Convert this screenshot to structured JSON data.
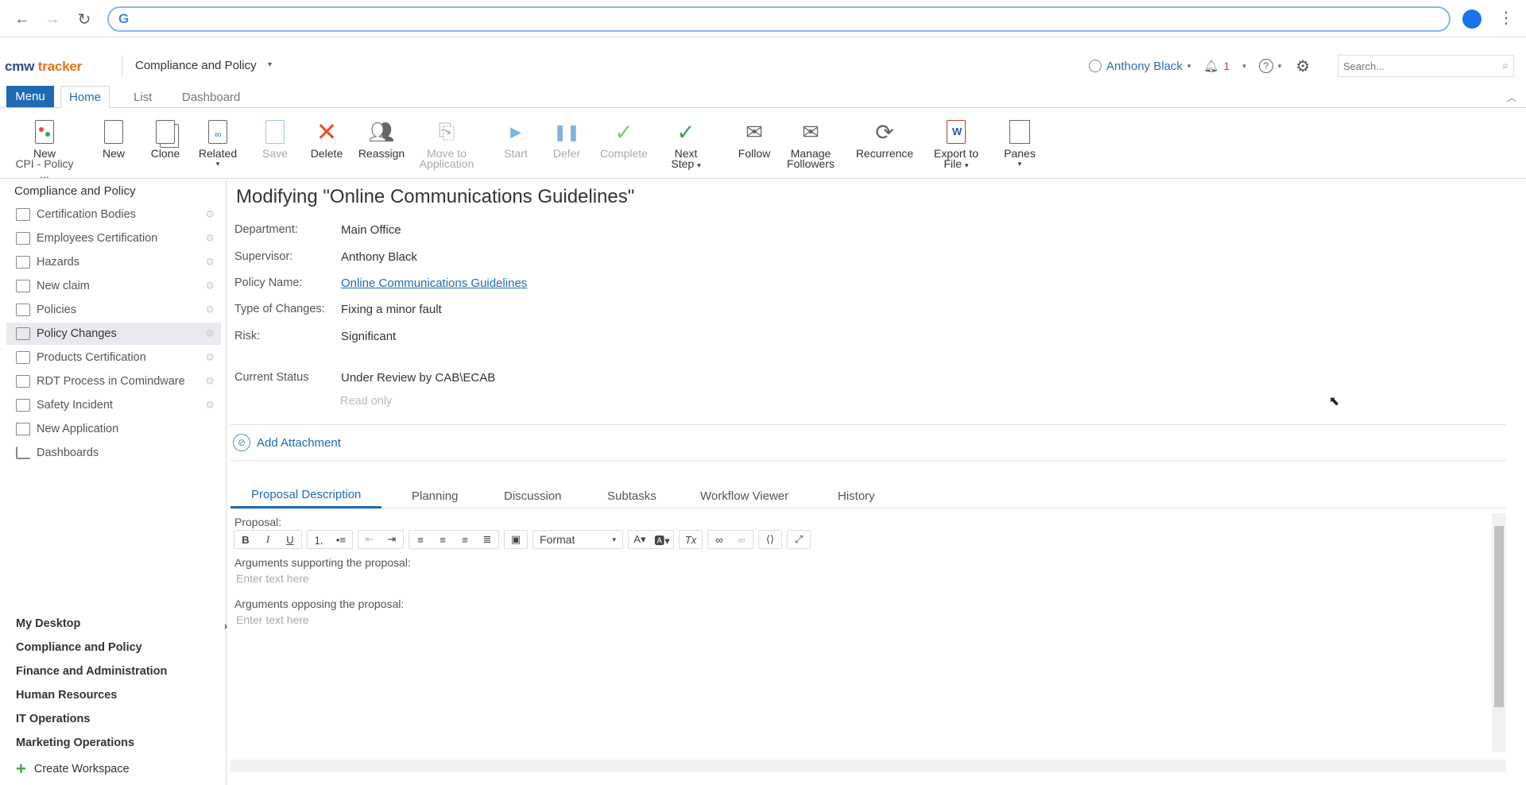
{
  "browser": {
    "omnibox_value": "",
    "search_engine_icon": "google-g-icon"
  },
  "header": {
    "logo_part1": "cmw",
    "logo_part2": "tracker",
    "workspace": "Compliance and Policy",
    "user": "Anthony Black",
    "notification_count": "1",
    "search_placeholder": "Search..."
  },
  "tabs": {
    "menu": "Menu",
    "home": "Home",
    "list": "List",
    "dashboard": "Dashboard"
  },
  "ribbon": {
    "new_cpi": [
      "New",
      "CPI - Policy ..."
    ],
    "new": "New",
    "clone": "Clone",
    "related": "Related",
    "save": "Save",
    "delete": "Delete",
    "reassign": "Reassign",
    "move_to_app": [
      "Move to",
      "Application"
    ],
    "start": "Start",
    "defer": "Defer",
    "complete": "Complete",
    "next_step": [
      "Next",
      "Step"
    ],
    "follow": "Follow",
    "manage_followers": [
      "Manage",
      "Followers"
    ],
    "recurrence": "Recurrence",
    "export": [
      "Export to",
      "File"
    ],
    "panes": "Panes"
  },
  "sidebar": {
    "heading": "Compliance and Policy",
    "items": [
      {
        "label": "Certification Bodies"
      },
      {
        "label": "Employees Certification"
      },
      {
        "label": "Hazards"
      },
      {
        "label": "New claim"
      },
      {
        "label": "Policies"
      },
      {
        "label": "Policy Changes"
      },
      {
        "label": "Products Certification"
      },
      {
        "label": "RDT Process in Comindware"
      },
      {
        "label": "Safety Incident"
      },
      {
        "label": "New Application"
      },
      {
        "label": "Dashboards"
      }
    ],
    "workspaces": [
      "My Desktop",
      "Compliance and Policy",
      "Finance and Administration",
      "Human Resources",
      "IT Operations",
      "Marketing Operations"
    ],
    "create_workspace": "Create Workspace"
  },
  "main": {
    "title": "Modifying \"Online Communications Guidelines\"",
    "fields": [
      {
        "label": "Department:",
        "value": "Main Office"
      },
      {
        "label": "Supervisor:",
        "value": "Anthony Black"
      },
      {
        "label": "Policy Name:",
        "value": "Online Communications Guidelines"
      },
      {
        "label": "Type of Changes:",
        "value": "Fixing a minor fault"
      },
      {
        "label": "Risk:",
        "value": "Significant"
      },
      {
        "label": "Current Status",
        "value": "Under Review by CAB\\ECAB"
      }
    ],
    "read_only": "Read only",
    "add_attachment": "Add Attachment",
    "subtabs": [
      "Proposal Description",
      "Planning",
      "Discussion",
      "Subtasks",
      "Workflow Viewer",
      "History"
    ],
    "proposal_label": "Proposal:",
    "format_label": "Format",
    "args_for_label": "Arguments supporting the proposal:",
    "args_against_label": "Arguments opposing the proposal:",
    "placeholder": "Enter text here"
  }
}
